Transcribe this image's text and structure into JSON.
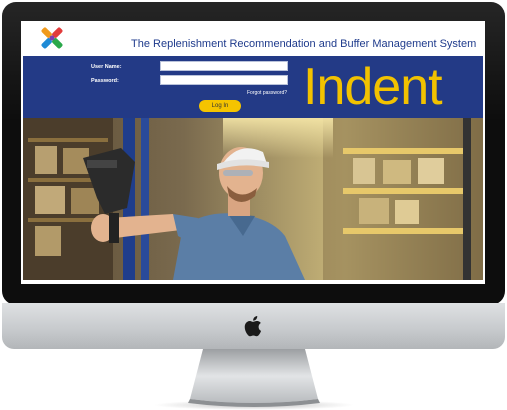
{
  "header": {
    "system_title": "The Replenishment Recommendation and Buffer Management System"
  },
  "login": {
    "username_label": "User Name:",
    "password_label": "Password:",
    "username_value": "",
    "password_value": "",
    "forgot_password": "Forgot password?",
    "login_button": "Log In"
  },
  "brand": {
    "word": "Indent"
  },
  "colors": {
    "banner": "#233a86",
    "brand_yellow": "#f2c200",
    "title_blue": "#1f3b8c"
  },
  "icons": {
    "logo": "colorful-x-logo",
    "device": "apple-logo-icon"
  }
}
